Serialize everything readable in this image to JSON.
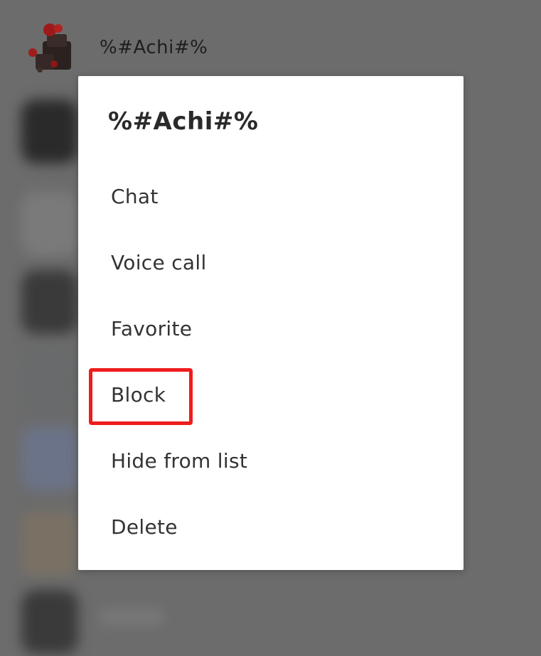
{
  "header": {
    "contact_name": "%#Achi#%"
  },
  "dialog": {
    "title": "%#Achi#%",
    "items": [
      {
        "label": "Chat"
      },
      {
        "label": "Voice call"
      },
      {
        "label": "Favorite"
      },
      {
        "label": "Block"
      },
      {
        "label": "Hide from list"
      },
      {
        "label": "Delete"
      }
    ]
  },
  "colors": {
    "overlay": "#6c6c6c",
    "dialog_bg": "#ffffff",
    "highlight": "#ef1c1c",
    "text": "#333333"
  },
  "annotations": {
    "highlighted_item": "Block"
  }
}
